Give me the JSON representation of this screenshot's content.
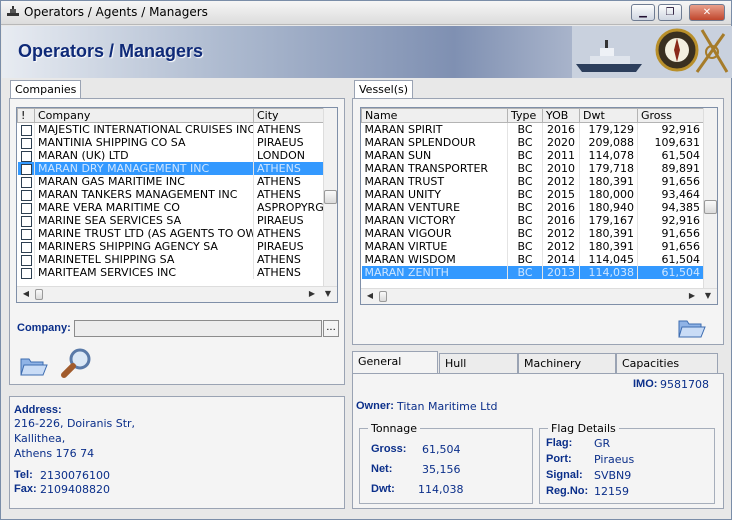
{
  "window": {
    "title": "Operators / Agents / Managers",
    "minimize": "▁",
    "restore": "❐",
    "close": "✕"
  },
  "banner": {
    "title": "Operators / Managers"
  },
  "companies": {
    "tab_label": "Companies",
    "columns": [
      "!",
      "Company",
      "City"
    ],
    "rows": [
      {
        "company": "MAJESTIC INTERNATIONAL CRUISES INC",
        "city": "ATHENS",
        "selected": false
      },
      {
        "company": "MANTINIA SHIPPING CO SA",
        "city": "PIRAEUS",
        "selected": false
      },
      {
        "company": "MARAN (UK) LTD",
        "city": "LONDON",
        "selected": false
      },
      {
        "company": "MARAN DRY MANAGEMENT INC",
        "city": "ATHENS",
        "selected": true
      },
      {
        "company": "MARAN GAS MARITIME INC",
        "city": "ATHENS",
        "selected": false
      },
      {
        "company": "MARAN TANKERS MANAGEMENT INC",
        "city": "ATHENS",
        "selected": false
      },
      {
        "company": "MARE VERA MARITIME CO",
        "city": "ASPROPYRG",
        "selected": false
      },
      {
        "company": "MARINE SEA SERVICES SA",
        "city": "PIRAEUS",
        "selected": false
      },
      {
        "company": "MARINE TRUST LTD (AS AGENTS TO OW",
        "city": "ATHENS",
        "selected": false
      },
      {
        "company": "MARINERS SHIPPING AGENCY SA",
        "city": "PIRAEUS",
        "selected": false
      },
      {
        "company": "MARINETEL SHIPPING SA",
        "city": "ATHENS",
        "selected": false
      },
      {
        "company": "MARITEAM SERVICES INC",
        "city": "ATHENS",
        "selected": false
      }
    ],
    "company_label": "Company:",
    "company_value": "",
    "browse_label": "...",
    "open_icon": "folder-open-icon",
    "search_icon": "magnifier-icon"
  },
  "address": {
    "label": "Address:",
    "line1": "216-226, Doiranis Str,",
    "line2": "Kallithea,",
    "line3": "Athens 176 74",
    "tel_label": "Tel:",
    "tel": "2130076100",
    "fax_label": "Fax:",
    "fax": "2109408820"
  },
  "vessels": {
    "tab_label": "Vessel(s)",
    "columns": [
      "Name",
      "Type",
      "YOB",
      "Dwt",
      "Gross"
    ],
    "rows": [
      {
        "name": "MARAN SPIRIT",
        "type": "BC",
        "yob": "2016",
        "dwt": "179,129",
        "gross": "92,916",
        "selected": false
      },
      {
        "name": "MARAN SPLENDOUR",
        "type": "BC",
        "yob": "2020",
        "dwt": "209,088",
        "gross": "109,631",
        "selected": false
      },
      {
        "name": "MARAN SUN",
        "type": "BC",
        "yob": "2011",
        "dwt": "114,078",
        "gross": "61,504",
        "selected": false
      },
      {
        "name": "MARAN TRANSPORTER",
        "type": "BC",
        "yob": "2010",
        "dwt": "179,718",
        "gross": "89,891",
        "selected": false
      },
      {
        "name": "MARAN TRUST",
        "type": "BC",
        "yob": "2012",
        "dwt": "180,391",
        "gross": "91,656",
        "selected": false
      },
      {
        "name": "MARAN UNITY",
        "type": "BC",
        "yob": "2015",
        "dwt": "180,000",
        "gross": "93,464",
        "selected": false
      },
      {
        "name": "MARAN VENTURE",
        "type": "BC",
        "yob": "2016",
        "dwt": "180,940",
        "gross": "94,385",
        "selected": false
      },
      {
        "name": "MARAN VICTORY",
        "type": "BC",
        "yob": "2016",
        "dwt": "179,167",
        "gross": "92,916",
        "selected": false
      },
      {
        "name": "MARAN VIGOUR",
        "type": "BC",
        "yob": "2012",
        "dwt": "180,391",
        "gross": "91,656",
        "selected": false
      },
      {
        "name": "MARAN VIRTUE",
        "type": "BC",
        "yob": "2012",
        "dwt": "180,391",
        "gross": "91,656",
        "selected": false
      },
      {
        "name": "MARAN WISDOM",
        "type": "BC",
        "yob": "2014",
        "dwt": "114,045",
        "gross": "61,504",
        "selected": false
      },
      {
        "name": "MARAN ZENITH",
        "type": "BC",
        "yob": "2013",
        "dwt": "114,038",
        "gross": "61,504",
        "selected": true
      }
    ],
    "open_icon": "folder-open-icon"
  },
  "details": {
    "tabs": [
      "General",
      "Hull",
      "Machinery",
      "Capacities"
    ],
    "imo_label": "IMO:",
    "imo": "9581708",
    "owner_label": "Owner:",
    "owner": "Titan Maritime Ltd",
    "tonnage": {
      "legend": "Tonnage",
      "gross_label": "Gross:",
      "gross": "61,504",
      "net_label": "Net:",
      "net": "35,156",
      "dwt_label": "Dwt:",
      "dwt": "114,038"
    },
    "flag": {
      "legend": "Flag Details",
      "flag_label": "Flag:",
      "flag": "GR",
      "port_label": "Port:",
      "port": "Piraeus",
      "signal_label": "Signal:",
      "signal": "SVBN9",
      "regno_label": "Reg.No:",
      "regno": "12159"
    }
  }
}
